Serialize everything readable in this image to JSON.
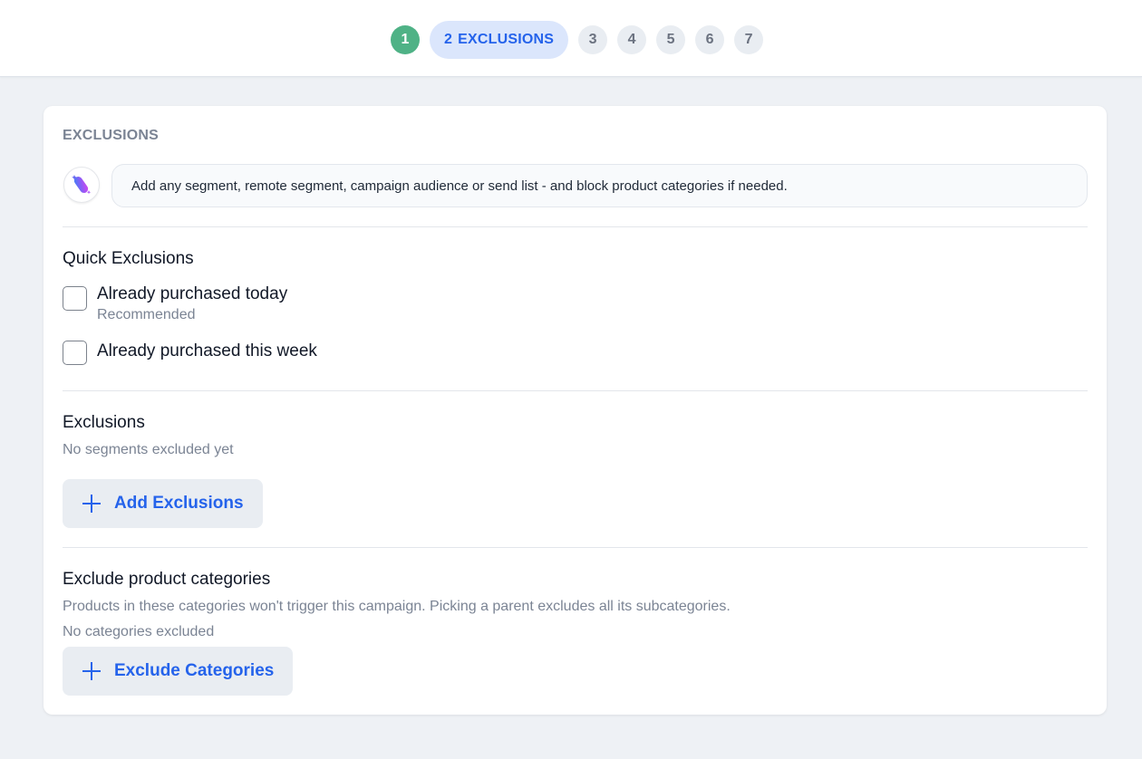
{
  "stepper": {
    "steps": [
      {
        "number": "1",
        "state": "completed"
      },
      {
        "number": "2",
        "label": "EXCLUSIONS",
        "state": "active"
      },
      {
        "number": "3",
        "state": "upcoming"
      },
      {
        "number": "4",
        "state": "upcoming"
      },
      {
        "number": "5",
        "state": "upcoming"
      },
      {
        "number": "6",
        "state": "upcoming"
      },
      {
        "number": "7",
        "state": "upcoming"
      }
    ]
  },
  "card": {
    "title": "EXCLUSIONS",
    "assistant": {
      "icon": "ai-assistant-icon",
      "message": "Add any segment, remote segment, campaign audience or send list - and block product categories if needed."
    },
    "quick_exclusions": {
      "title": "Quick Exclusions",
      "options": [
        {
          "label": "Already purchased today",
          "sublabel": "Recommended",
          "checked": false
        },
        {
          "label": "Already purchased this week",
          "checked": false
        }
      ]
    },
    "exclusions": {
      "title": "Exclusions",
      "empty_text": "No segments excluded yet",
      "add_button": "Add Exclusions"
    },
    "product_categories": {
      "title": "Exclude product categories",
      "description": "Products in these categories won't trigger this campaign. Picking a parent excludes all its subcategories.",
      "empty_text": "No categories excluded",
      "add_button": "Exclude Categories"
    }
  },
  "colors": {
    "completed_step": "#4fb286",
    "active_step_bg": "#dbe6fc",
    "accent": "#2563eb"
  }
}
